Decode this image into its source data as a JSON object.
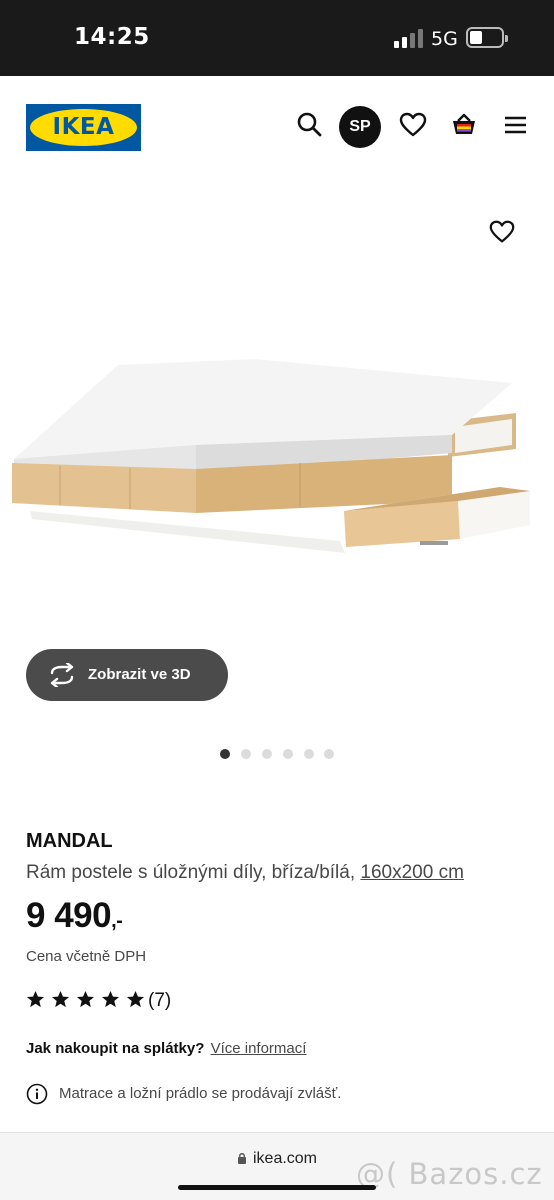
{
  "status_bar": {
    "time": "14:25",
    "network": "5G"
  },
  "header": {
    "logo_text": "IKEA",
    "avatar_initials": "SP",
    "icons": [
      "search-icon",
      "heart-icon",
      "cart-icon",
      "menu-icon"
    ]
  },
  "gallery": {
    "view_3d_label": "Zobrazit ve 3D",
    "slide_count": 6,
    "active_slide": 1
  },
  "product": {
    "name": "MANDAL",
    "description": "Rám postele s úložnými díly, bříza/bílá,",
    "size_link": "160x200 cm",
    "price_main": "9 490",
    "price_decimal": ",-",
    "vat_note": "Cena včetně DPH",
    "rating": 5,
    "rating_max": 5,
    "reviews_count": "(7)",
    "installment_question": "Jak nakoupit na splátky?",
    "installment_link": "Více informací",
    "notice_text": "Matrace a ložní prádlo se prodávají zvlášť."
  },
  "browser": {
    "url": "ikea.com",
    "watermark": "@( Bazos.cz"
  },
  "colors": {
    "ikea_blue": "#0058a3",
    "ikea_yellow": "#ffdb00",
    "dark_button": "#4b4b4b",
    "status_bar": "#1a1a1a"
  }
}
